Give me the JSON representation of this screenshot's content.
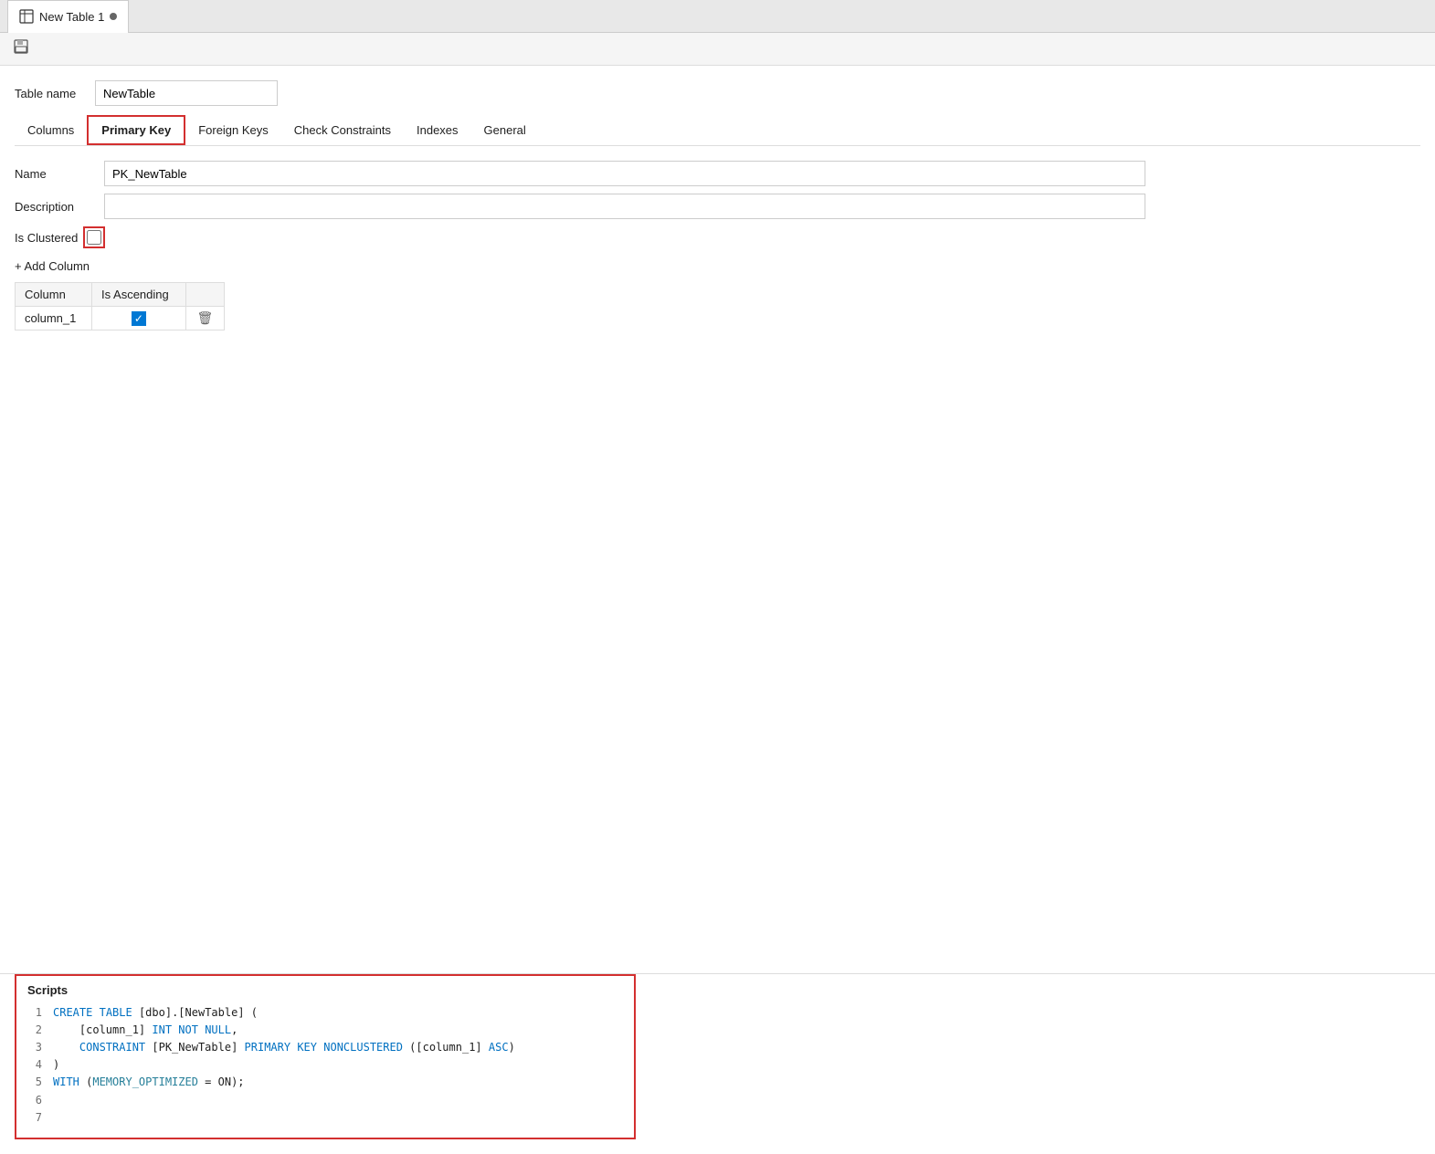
{
  "tab": {
    "icon": "table-icon",
    "title": "New Table 1",
    "dot": true
  },
  "toolbar": {
    "save_icon": "💾"
  },
  "table_name_label": "Table name",
  "table_name_value": "NewTable",
  "nav_tabs": [
    {
      "id": "columns",
      "label": "Columns",
      "active": false
    },
    {
      "id": "primary-key",
      "label": "Primary Key",
      "active": true
    },
    {
      "id": "foreign-keys",
      "label": "Foreign Keys",
      "active": false
    },
    {
      "id": "check-constraints",
      "label": "Check Constraints",
      "active": false
    },
    {
      "id": "indexes",
      "label": "Indexes",
      "active": false
    },
    {
      "id": "general",
      "label": "General",
      "active": false
    }
  ],
  "name_label": "Name",
  "name_value": "PK_NewTable",
  "description_label": "Description",
  "description_value": "",
  "is_clustered_label": "Is Clustered",
  "is_clustered_checked": false,
  "add_column_label": "+ Add Column",
  "table_columns": {
    "headers": [
      "Column",
      "Is Ascending",
      ""
    ],
    "rows": [
      {
        "column": "column_1",
        "is_ascending": true
      }
    ]
  },
  "scripts": {
    "header": "Scripts",
    "lines": [
      {
        "num": "1",
        "content": "CREATE TABLE [dbo].[NewTable] ("
      },
      {
        "num": "2",
        "content": "    [column_1] INT NOT NULL,"
      },
      {
        "num": "3",
        "content": "    CONSTRAINT [PK_NewTable] PRIMARY KEY NONCLUSTERED ([column_1] ASC)"
      },
      {
        "num": "4",
        "content": ")"
      },
      {
        "num": "5",
        "content": "WITH (MEMORY_OPTIMIZED = ON);"
      },
      {
        "num": "6",
        "content": ""
      },
      {
        "num": "7",
        "content": ""
      }
    ]
  }
}
